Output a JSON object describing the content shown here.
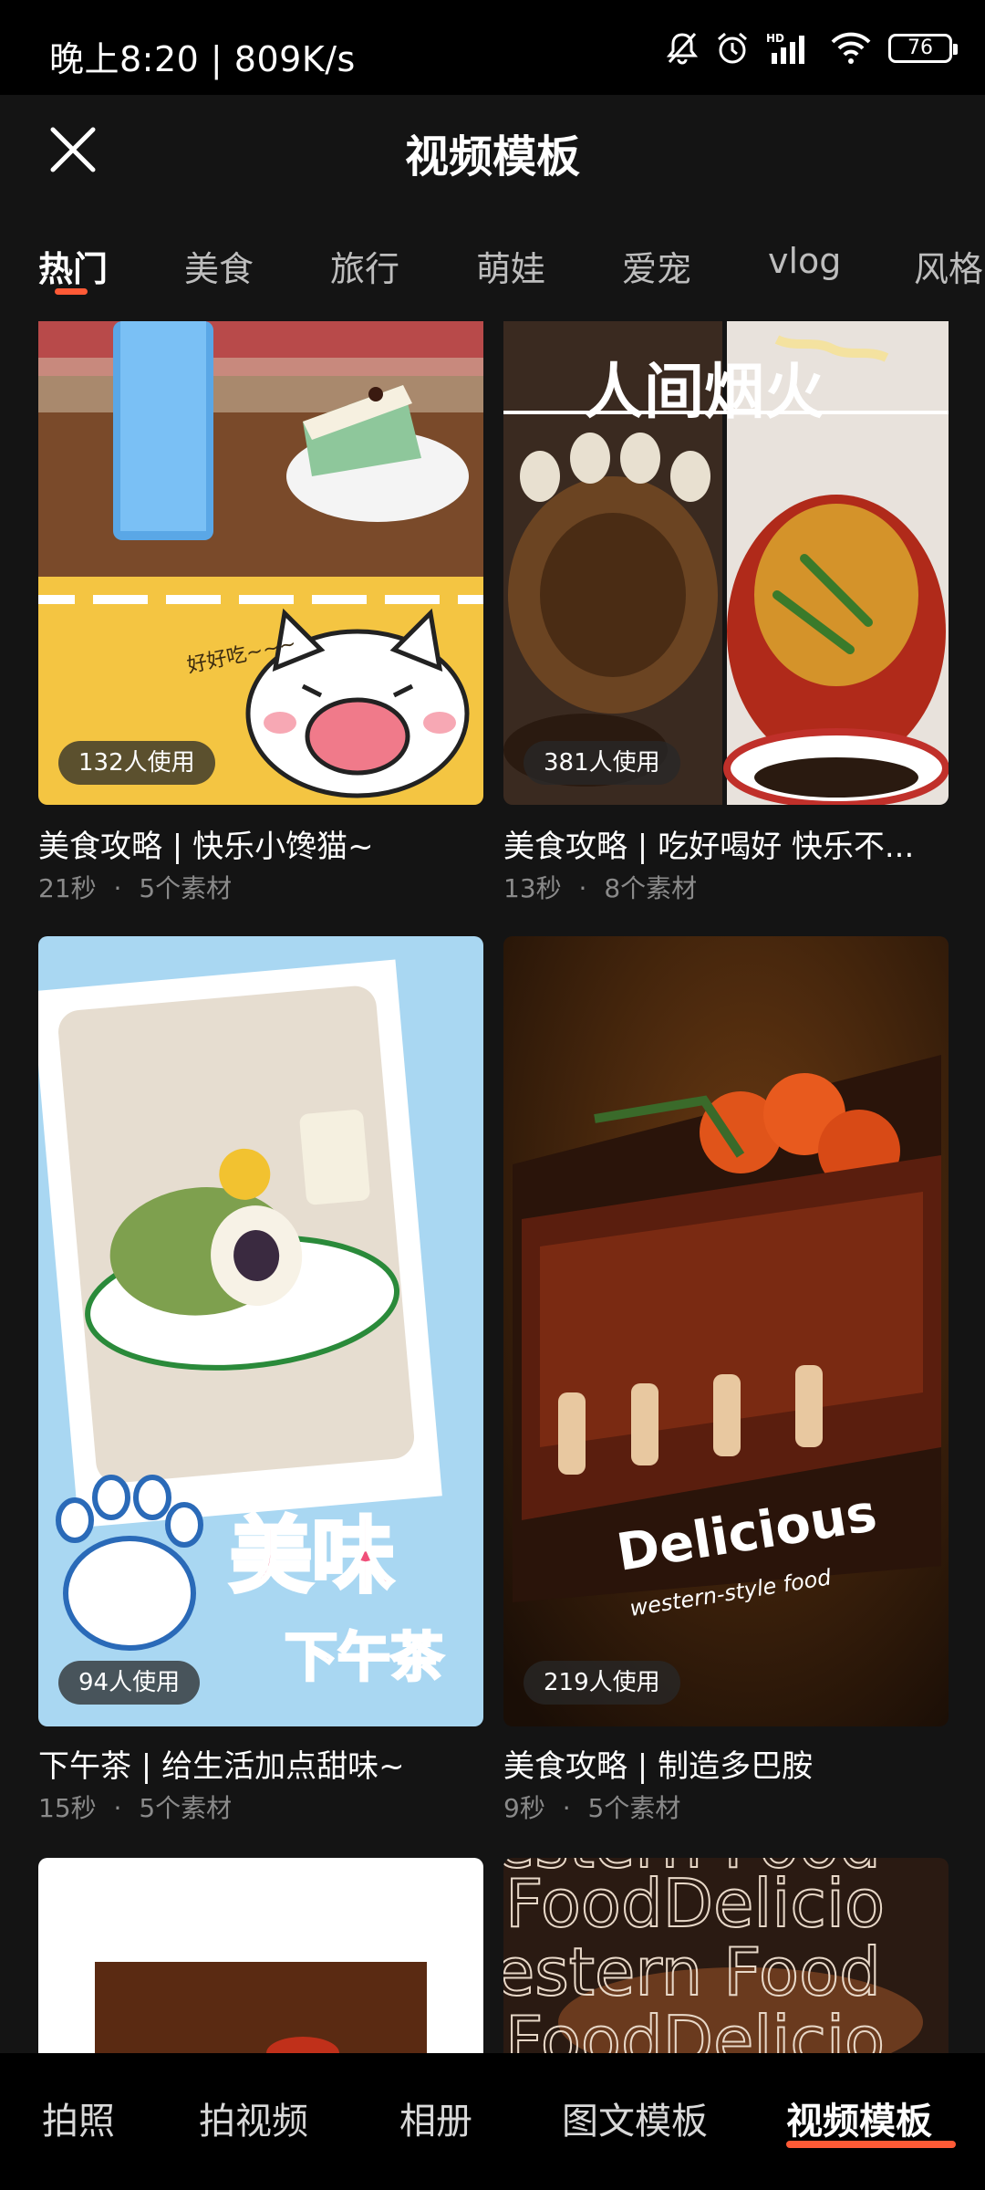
{
  "status_bar": {
    "time": "晚上8:20 | 809K/s",
    "battery": "76",
    "icons": [
      "mute-icon",
      "alarm-icon",
      "hd-signal-icon",
      "wifi-icon",
      "battery-icon"
    ]
  },
  "header": {
    "title": "视频模板",
    "close_icon": "close-icon"
  },
  "tabs": [
    {
      "label": "热门",
      "active": true
    },
    {
      "label": "美食",
      "active": false
    },
    {
      "label": "旅行",
      "active": false
    },
    {
      "label": "萌娃",
      "active": false
    },
    {
      "label": "爱宠",
      "active": false
    },
    {
      "label": "vlog",
      "active": false
    },
    {
      "label": "风格",
      "active": false
    }
  ],
  "templates": [
    {
      "usage": "132人使用",
      "title": "美食攻略 | 快乐小馋猫~",
      "duration": "21秒",
      "materials": "5个素材"
    },
    {
      "usage": "381人使用",
      "title": "美食攻略 | 吃好喝好 快乐不...",
      "duration": "13秒",
      "materials": "8个素材",
      "overlay_text": "人间烟火"
    },
    {
      "usage": "94人使用",
      "title": "下午茶 | 给生活加点甜味~",
      "duration": "15秒",
      "materials": "5个素材",
      "overlay_text_1": "美味",
      "overlay_text_2": "下午茶"
    },
    {
      "usage": "219人使用",
      "title": "美食攻略 | 制造多巴胺",
      "duration": "9秒",
      "materials": "5个素材",
      "overlay_text_1": "Delicious",
      "overlay_text_2": "western-style food"
    },
    {},
    {
      "overlay_lines": [
        "estern Food",
        "FoodDelicio",
        "estern Food",
        "FoodDelicio"
      ]
    }
  ],
  "meta_separator": "·",
  "bottom_nav": [
    {
      "label": "拍照",
      "active": false
    },
    {
      "label": "拍视频",
      "active": false
    },
    {
      "label": "相册",
      "active": false
    },
    {
      "label": "图文模板",
      "active": false
    },
    {
      "label": "视频模板",
      "active": true
    }
  ],
  "colors": {
    "accent": "#ff5a36",
    "background": "#141414"
  }
}
